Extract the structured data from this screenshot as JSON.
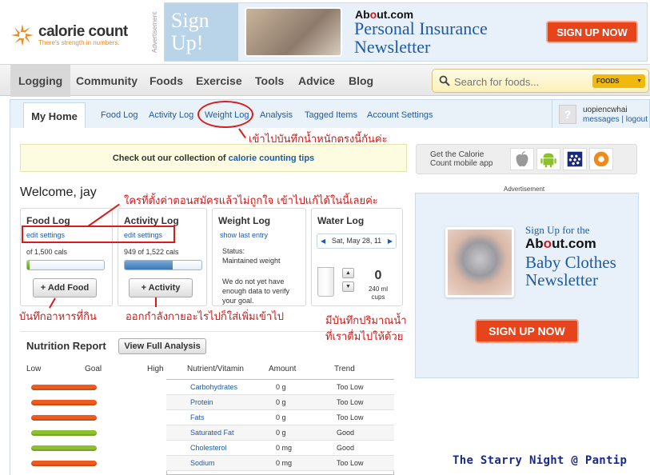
{
  "logo": {
    "name": "calorie count",
    "tagline": "There's strength in numbers."
  },
  "top_ad": {
    "vertical_label": "Advertisement",
    "signup": "Sign Up!",
    "about_pre": "Ab",
    "about_mid": "o",
    "about_post": "ut.com",
    "headline_line1": "Personal Insurance",
    "headline_line2": "Newsletter",
    "button": "SIGN UP NOW"
  },
  "nav": {
    "items": [
      "Logging",
      "Community",
      "Foods",
      "Exercise",
      "Tools",
      "Advice",
      "Blog"
    ],
    "active": "Logging"
  },
  "search": {
    "placeholder": "Search for foods...",
    "category": "FOODS"
  },
  "subnav": {
    "home": "My Home",
    "items": [
      "Food Log",
      "Activity Log",
      "Weight Log",
      "Analysis",
      "Tagged Items",
      "Account Settings"
    ]
  },
  "user": {
    "name": "uopiencwhai",
    "messages": "messages",
    "separator": "|",
    "logout": "logout",
    "avatar": "?"
  },
  "tips": {
    "prefix": "Check out our collection of",
    "link": "calorie counting tips"
  },
  "mobile": {
    "line1": "Get the Calorie",
    "line2": "Count mobile app"
  },
  "welcome": "Welcome, jay",
  "food_log": {
    "title": "Food Log",
    "link": "edit settings",
    "progress": "of 1,500 cals",
    "fill": 0.03,
    "button": "+ Add Food"
  },
  "activity_log": {
    "title": "Activity Log",
    "link": "edit settings",
    "progress": "949 of 1,522 cals",
    "fill": 0.62,
    "button": "+ Activity"
  },
  "weight_log": {
    "title": "Weight Log",
    "link": "show last entry",
    "status_label": "Status:",
    "status_value": "Maintained weight",
    "note_l1": "We do not yet have",
    "note_l2": "enough data to verify",
    "note_l3": "your goal."
  },
  "water_log": {
    "title": "Water Log",
    "date": "Sat, May 28, 11",
    "count": "0",
    "unit_l1": "240 ml",
    "unit_l2": "cups"
  },
  "annotations": {
    "weight": "เข้าไปบันทึกน้ำหนักตรงนี้กันค่ะ",
    "settings": "ใครที่ตั้งค่าตอนสมัครแล้วไม่ถูกใจ เข้าไปแก้ได้ในนี้เลยค่ะ",
    "food": "บันทึกอาหารที่กิน",
    "activity": "ออกกำลังกายอะไรไปก็ใส่เพิ่มเข้าไป",
    "water_l1": "มีบันทึกปริมาณน้ำ",
    "water_l2": "ที่เราดื่มไปให้ด้วย"
  },
  "nutrition": {
    "title": "Nutrition Report",
    "button": "View Full Analysis",
    "headers": [
      "Low",
      "Goal",
      "High",
      "Nutrient/Vitamin",
      "Amount",
      "Trend"
    ],
    "rows": [
      {
        "name": "Carbohydrates",
        "amount": "0 g",
        "trend": "Too Low",
        "color": "#ef5b1e"
      },
      {
        "name": "Protein",
        "amount": "0 g",
        "trend": "Too Low",
        "color": "#ef5b1e"
      },
      {
        "name": "Fats",
        "amount": "0 g",
        "trend": "Too Low",
        "color": "#ef5b1e"
      },
      {
        "name": "Saturated Fat",
        "amount": "0 g",
        "trend": "Good",
        "color": "#8cc02e"
      },
      {
        "name": "Cholesterol",
        "amount": "0 mg",
        "trend": "Good",
        "color": "#8cc02e"
      },
      {
        "name": "Sodium",
        "amount": "0 mg",
        "trend": "Too Low",
        "color": "#ef5b1e"
      }
    ]
  },
  "right_ad": {
    "label": "Advertisement",
    "sign": "Sign Up for the",
    "about_pre": "Ab",
    "about_mid": "o",
    "about_post": "ut.com",
    "headline_l1": "Baby Clothes",
    "headline_l2": "Newsletter",
    "button": "SIGN UP NOW"
  },
  "watermark": "The Starry Night @ Pantip",
  "colors": {
    "accent_orange": "#f08a1c",
    "link_blue": "#1f5aa6",
    "annotation_red": "#d81c1c",
    "ad_button": "#e8441c"
  }
}
